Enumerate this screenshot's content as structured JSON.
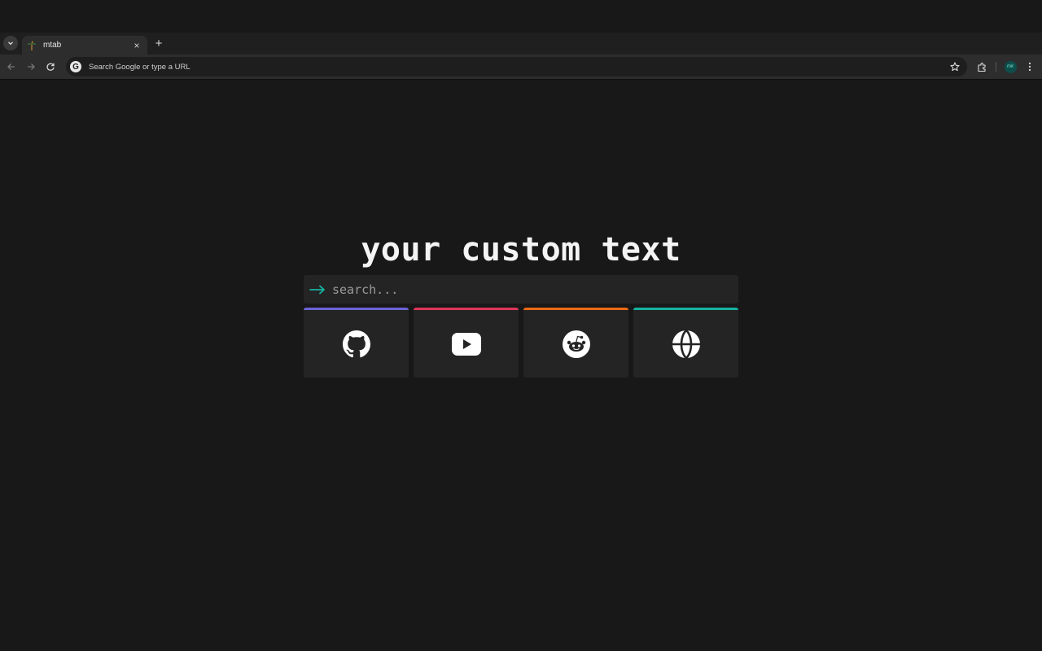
{
  "browser": {
    "tab": {
      "title": "mtab",
      "favicon": "palm-tree-icon"
    },
    "tab_menu_icon": "chevron-down-icon",
    "new_tab_label": "+",
    "close_tab_label": "×",
    "omnibox": {
      "placeholder": "Search Google or type a URL",
      "icon": "google-icon",
      "icon_letter": "G"
    },
    "avatar_text": "mk"
  },
  "page": {
    "heading": "your custom text",
    "search": {
      "placeholder": "search..."
    },
    "links": [
      {
        "name": "github",
        "icon": "github-icon",
        "accent": "#6c63d9"
      },
      {
        "name": "youtube",
        "icon": "youtube-icon",
        "accent": "#e0355a"
      },
      {
        "name": "reddit",
        "icon": "reddit-icon",
        "accent": "#ee6a17"
      },
      {
        "name": "web",
        "icon": "globe-icon",
        "accent": "#16b3a1"
      }
    ],
    "colors": {
      "background": "#181818",
      "card": "#242424",
      "search_arrow": "#16b3a1",
      "text": "#f4f4f4"
    }
  }
}
